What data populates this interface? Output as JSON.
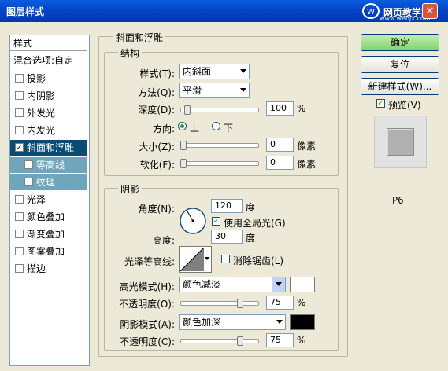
{
  "window": {
    "title": "图层样式",
    "logo_text": "网页教学网",
    "logo_sub": "www.webjx.com",
    "close_glyph": "✕"
  },
  "style_list": {
    "header": "样式",
    "blend_options": "混合选项:自定",
    "items": [
      {
        "label": "投影",
        "checked": false
      },
      {
        "label": "内阴影",
        "checked": false
      },
      {
        "label": "外发光",
        "checked": false
      },
      {
        "label": "内发光",
        "checked": false
      },
      {
        "label": "斜面和浮雕",
        "checked": true,
        "selected": true
      },
      {
        "label": "等高线",
        "checked": false,
        "sub": true
      },
      {
        "label": "纹理",
        "checked": false,
        "sub": true
      },
      {
        "label": "光泽",
        "checked": false
      },
      {
        "label": "颜色叠加",
        "checked": false
      },
      {
        "label": "渐变叠加",
        "checked": false
      },
      {
        "label": "图案叠加",
        "checked": false
      },
      {
        "label": "描边",
        "checked": false
      }
    ]
  },
  "bevel": {
    "title": "斜面和浮雕",
    "structure": {
      "title": "结构",
      "style_label": "样式(T):",
      "style_value": "内斜面",
      "technique_label": "方法(Q):",
      "technique_value": "平滑",
      "depth_label": "深度(D):",
      "depth_value": "100",
      "depth_unit": "%",
      "direction_label": "方向:",
      "direction_up": "上",
      "direction_down": "下",
      "direction_selected": "up",
      "size_label": "大小(Z):",
      "size_value": "0",
      "size_unit": "像素",
      "soften_label": "软化(F):",
      "soften_value": "0",
      "soften_unit": "像素"
    },
    "shading": {
      "title": "阴影",
      "angle_label": "角度(N):",
      "angle_value": "120",
      "angle_unit": "度",
      "global_light_label": "使用全局光(G)",
      "global_light_checked": true,
      "altitude_label": "高度:",
      "altitude_value": "30",
      "altitude_unit": "度",
      "gloss_contour_label": "光泽等高线:",
      "anti_alias_label": "消除锯齿(L)",
      "anti_alias_checked": false,
      "highlight_mode_label": "高光模式(H):",
      "highlight_mode_value": "颜色减淡",
      "highlight_color": "#ffffff",
      "highlight_opacity_label": "不透明度(O):",
      "highlight_opacity_value": "75",
      "highlight_opacity_unit": "%",
      "shadow_mode_label": "阴影模式(A):",
      "shadow_mode_value": "颜色加深",
      "shadow_color": "#000000",
      "shadow_opacity_label": "不透明度(C):",
      "shadow_opacity_value": "75",
      "shadow_opacity_unit": "%"
    }
  },
  "buttons": {
    "ok": "确定",
    "reset": "复位",
    "new_style": "新建样式(W)...",
    "preview_label": "预览(V)",
    "preview_checked": true
  },
  "watermark": "P6"
}
